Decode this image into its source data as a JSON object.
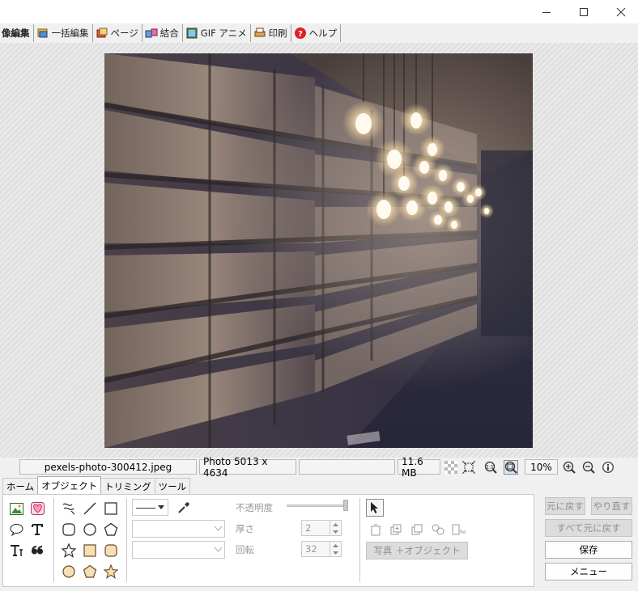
{
  "window": {
    "controls": {
      "minimize_icon": "minimize-icon",
      "maximize_icon": "maximize-icon",
      "close_icon": "close-icon"
    }
  },
  "main_tabs": [
    {
      "label": "像編集",
      "icon": ""
    },
    {
      "label": "一括編集",
      "icon": "batch-icon"
    },
    {
      "label": "ページ",
      "icon": "page-icon"
    },
    {
      "label": "結合",
      "icon": "combine-icon"
    },
    {
      "label": "GIF アニメ",
      "icon": "gif-icon"
    },
    {
      "label": "印刷",
      "icon": "printer-icon"
    },
    {
      "label": "ヘルプ",
      "icon": "help-icon"
    }
  ],
  "status": {
    "filename": "pexels-photo-300412.jpeg",
    "dimensions": "Photo 5013 x 4634",
    "empty_field": "",
    "filesize": "11.6 MB",
    "zoom": "10%"
  },
  "sub_tabs": [
    "ホーム",
    "オブジェクト",
    "トリミング",
    "ツール"
  ],
  "object_panel": {
    "opacity_label": "不透明度",
    "thickness_label": "厚さ",
    "thickness_value": "2",
    "rotation_label": "回転",
    "rotation_value": "32",
    "photo_object_button": "写真 ＋オブジェクト"
  },
  "right_buttons": {
    "undo": "元に戻す",
    "redo": "やり直す",
    "undo_all": "すべて元に戻す",
    "save": "保存",
    "menu": "メニュー"
  },
  "colors": {
    "accent_help": "#e02020",
    "photo_tone": "#2e2e40",
    "bulb_glow": "#fff4dc"
  }
}
